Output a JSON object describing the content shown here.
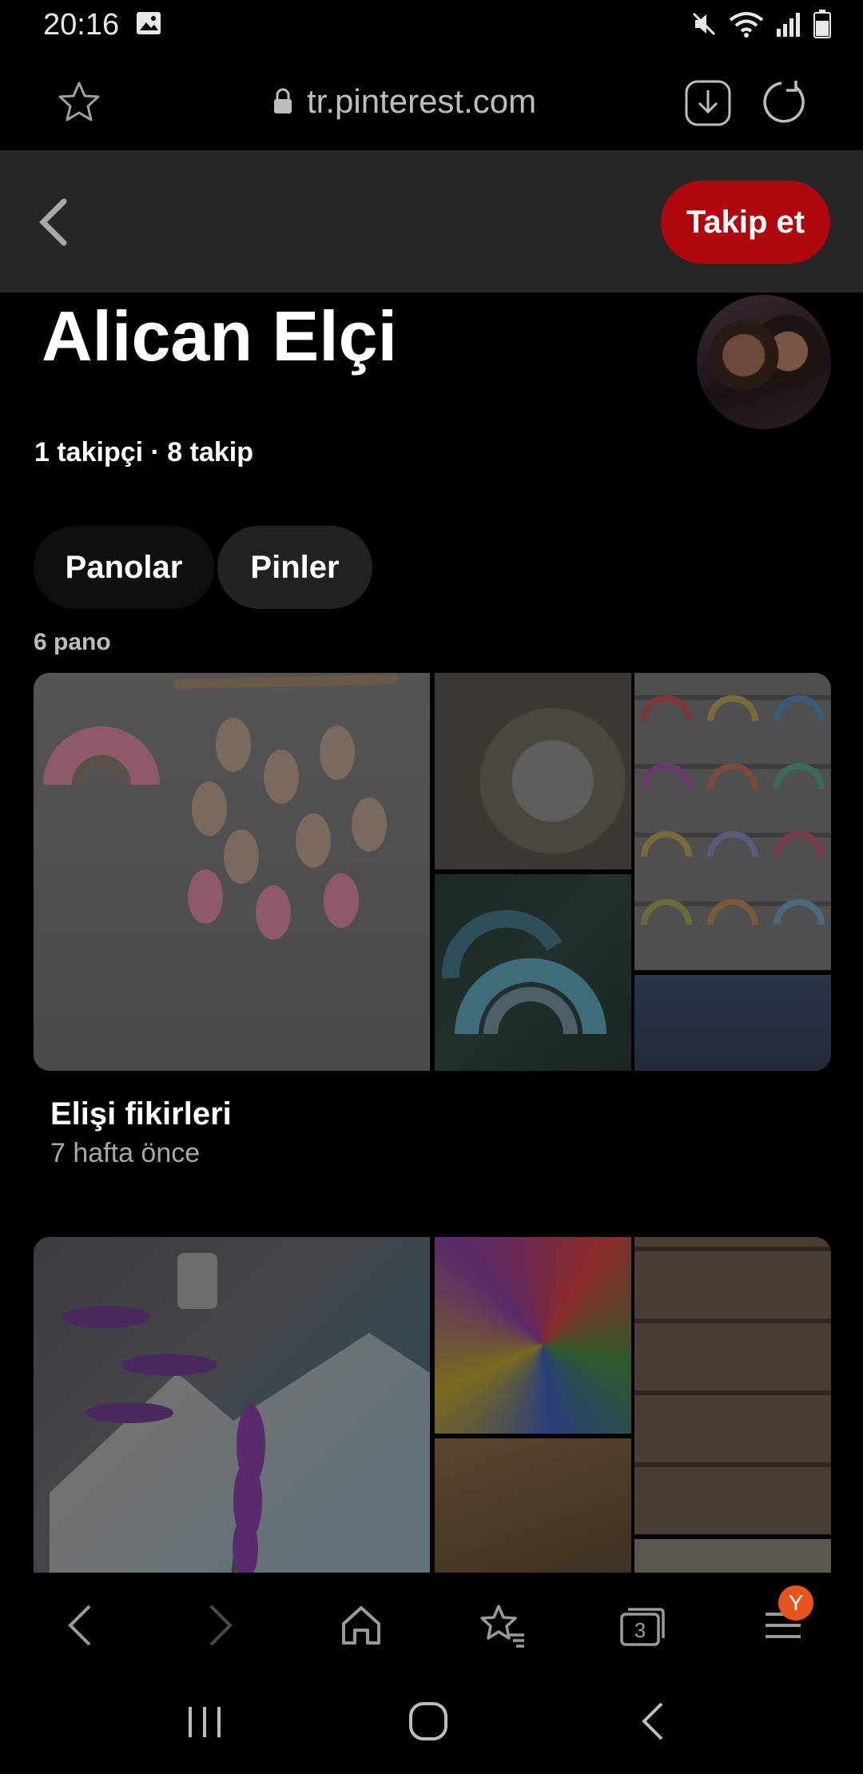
{
  "status_bar": {
    "time": "20:16",
    "icons": [
      "image-icon",
      "mute-icon",
      "wifi-icon",
      "signal-icon",
      "battery-icon"
    ]
  },
  "browser": {
    "url": "tr.pinterest.com",
    "tab_count": "3",
    "profile_badge": "Y"
  },
  "header": {
    "follow_label": "Takip et"
  },
  "profile": {
    "name": "Alican Elçi",
    "follow_counts": "1 takipçi · 8 takip"
  },
  "tabs": [
    {
      "label": "Panolar",
      "selected": false
    },
    {
      "label": "Pinler",
      "selected": true
    }
  ],
  "board_count": "6 pano",
  "boards": [
    {
      "title": "Elişi fikirleri",
      "time": "7 hafta önce"
    },
    {
      "title": "",
      "time": ""
    }
  ],
  "colors": {
    "follow_button": "#b0070f",
    "header_bg": "#262626",
    "badge": "#e8541e"
  }
}
